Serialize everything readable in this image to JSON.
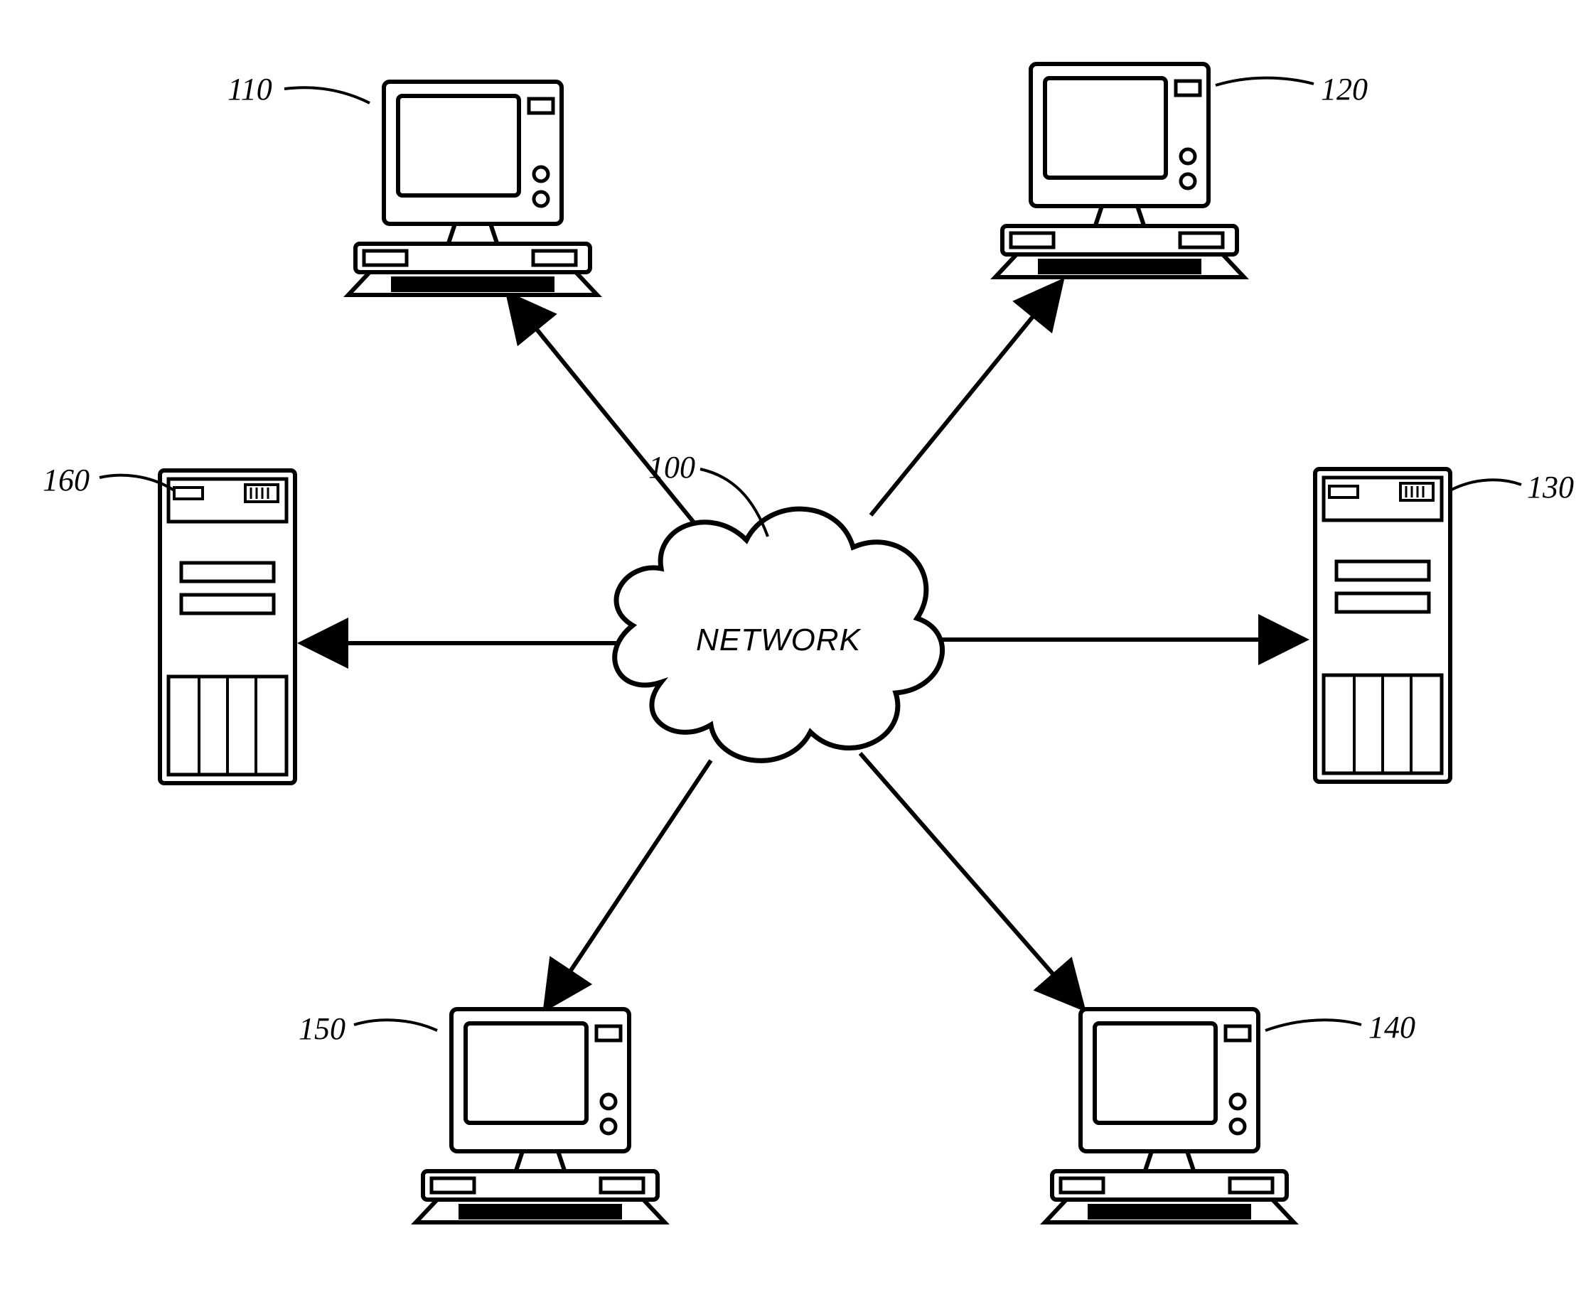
{
  "diagram": {
    "center_label": "NETWORK",
    "nodes": [
      {
        "id": "network",
        "ref": "100",
        "type": "cloud"
      },
      {
        "id": "pc_top_left",
        "ref": "110",
        "type": "desktop"
      },
      {
        "id": "pc_top_right",
        "ref": "120",
        "type": "desktop"
      },
      {
        "id": "server_right",
        "ref": "130",
        "type": "tower"
      },
      {
        "id": "pc_bottom_right",
        "ref": "140",
        "type": "desktop"
      },
      {
        "id": "pc_bottom_left",
        "ref": "150",
        "type": "desktop"
      },
      {
        "id": "server_left",
        "ref": "160",
        "type": "tower"
      }
    ]
  }
}
